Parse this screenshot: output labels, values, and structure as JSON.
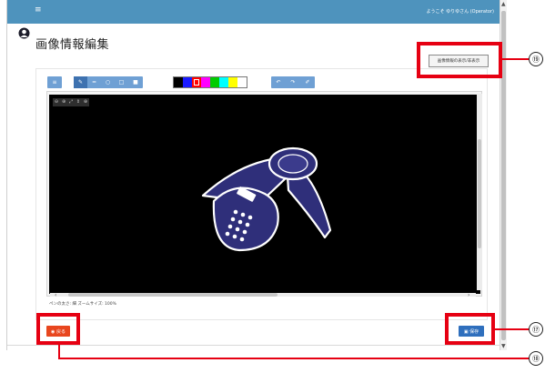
{
  "app": {
    "menu_glyph": "≡",
    "welcome_text": "ようこそ ゆりゆさん (Operator)"
  },
  "page": {
    "title": "画像情報編集",
    "toggle_button_label": "画像情報の表示/非表示"
  },
  "toolbar": {
    "list_icon": "≡",
    "draw_tools": [
      {
        "name": "pencil-tool",
        "glyph": "✎"
      },
      {
        "name": "line-tool",
        "glyph": "━"
      },
      {
        "name": "circle-tool",
        "glyph": "○"
      },
      {
        "name": "rectangle-tool",
        "glyph": "□"
      },
      {
        "name": "filled-rectangle-tool",
        "glyph": "■"
      }
    ],
    "history_tools": [
      {
        "name": "undo-tool",
        "glyph": "↶"
      },
      {
        "name": "redo-tool",
        "glyph": "↷"
      },
      {
        "name": "clear-tool",
        "glyph": "✐"
      }
    ]
  },
  "palette": {
    "colors": [
      "#000000",
      "#1a1aff",
      "#ff0000",
      "#ff00ff",
      "#00cc00",
      "#00ffff",
      "#ffff00",
      "#ffffff"
    ],
    "selected_index": 2
  },
  "zoom_tools": [
    "⊖",
    "⊕",
    "⤢",
    "⇕",
    "⊕"
  ],
  "status": {
    "text": "ペンの太さ: 細 ズームサイズ: 100%"
  },
  "buttons": {
    "return_label": "◉ 戻る",
    "save_label": "▣ 保存"
  },
  "callouts": {
    "c19": "⑲",
    "c17": "⑰",
    "c18": "⑱"
  },
  "colors": {
    "header_bar": "#4e93bd",
    "callout_red": "#e60012",
    "return_button": "#e8461e",
    "save_button": "#2f6fbd",
    "phone_fill": "#2f2f7a"
  }
}
